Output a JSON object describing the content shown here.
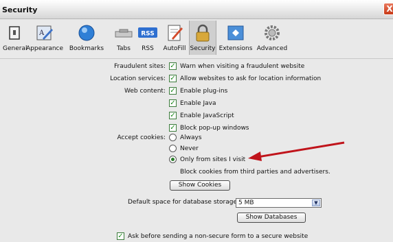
{
  "window": {
    "title": "Security",
    "close_glyph": "X"
  },
  "toolbar": {
    "items": [
      {
        "label": "General",
        "icon": "general-icon"
      },
      {
        "label": "Appearance",
        "icon": "appearance-icon"
      },
      {
        "label": "Bookmarks",
        "icon": "bookmarks-icon"
      },
      {
        "label": "Tabs",
        "icon": "tabs-icon"
      },
      {
        "label": "RSS",
        "icon": "rss-icon",
        "badge": "RSS"
      },
      {
        "label": "AutoFill",
        "icon": "autofill-icon"
      },
      {
        "label": "Security",
        "icon": "security-icon",
        "selected": true
      },
      {
        "label": "Extensions",
        "icon": "extensions-icon"
      },
      {
        "label": "Advanced",
        "icon": "advanced-icon"
      }
    ]
  },
  "security": {
    "fraudulent_label": "Fraudulent sites:",
    "fraudulent_option": "Warn when visiting a fraudulent website",
    "location_label": "Location services:",
    "location_option": "Allow websites to ask for location information",
    "web_content_label": "Web content:",
    "web_content_options": [
      "Enable plug-ins",
      "Enable Java",
      "Enable JavaScript",
      "Block pop-up windows"
    ],
    "cookies_label": "Accept cookies:",
    "cookies_options": [
      "Always",
      "Never",
      "Only from sites I visit"
    ],
    "cookies_selected": "Only from sites I visit",
    "cookies_note": "Block cookies from third parties and advertisers.",
    "show_cookies_button": "Show Cookies",
    "db_label": "Default space for database storage:",
    "db_value": "5 MB",
    "show_databases_button": "Show Databases",
    "insecure_form_option": "Ask before sending a non-secure form to a secure website"
  },
  "colors": {
    "arrow": "#c0141b",
    "check": "#1c8a1c",
    "toolbar_bg": "#e9e9e9"
  }
}
